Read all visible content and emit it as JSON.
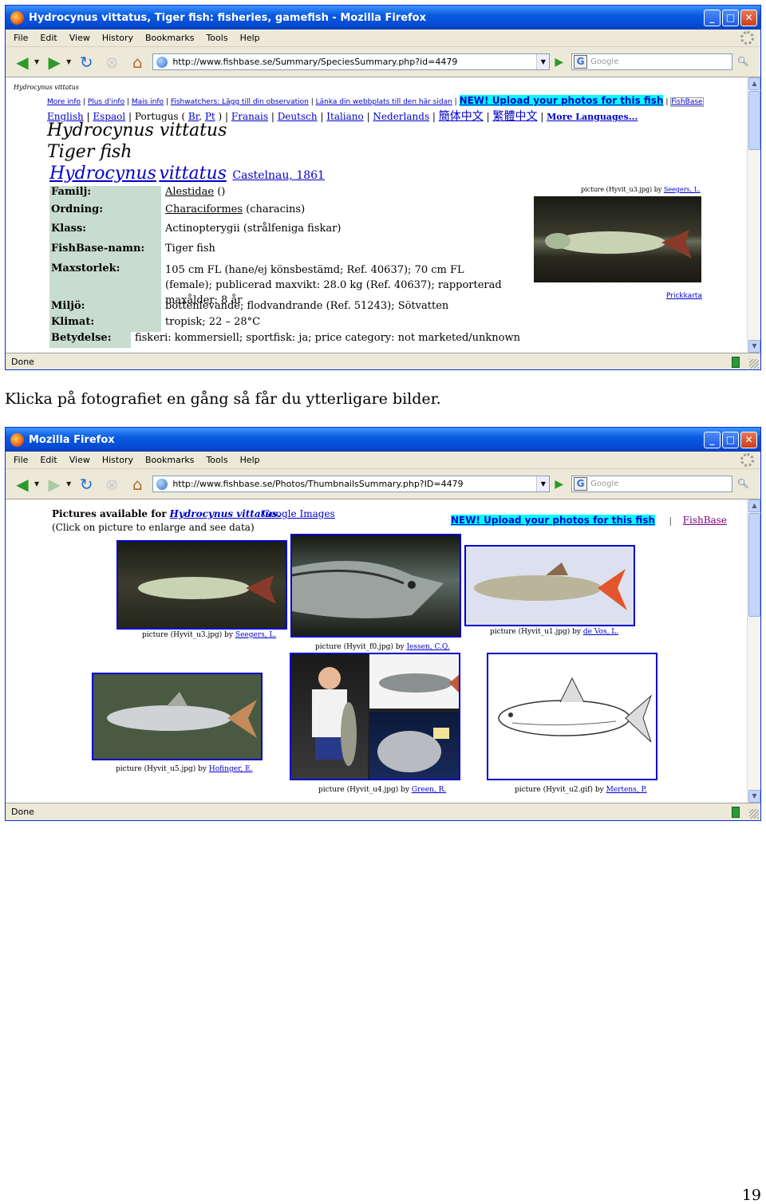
{
  "window1": {
    "title": "Hydrocynus vittatus, Tiger fish: fisheries, gamefish - Mozilla Firefox",
    "url": "http://www.fishbase.se/Summary/SpeciesSummary.php?id=4479",
    "status": "Done"
  },
  "window2": {
    "title": "Mozilla Firefox",
    "url": "http://www.fishbase.se/Photos/ThumbnailsSummary.php?ID=4479",
    "status": "Done"
  },
  "menu": [
    "File",
    "Edit",
    "View",
    "History",
    "Bookmarks",
    "Tools",
    "Help"
  ],
  "search_placeholder": "Google",
  "icons": {
    "back": "back-arrow-icon",
    "forward": "forward-arrow-icon",
    "reload": "reload-icon",
    "stop": "stop-icon",
    "home": "home-icon",
    "go": "go-icon",
    "search": "magnifier-icon"
  },
  "page1": {
    "breadcrumb": "Hydrocynus vittatus",
    "links": [
      "More info",
      "Plus d'info",
      "Mais info",
      "Fishwatchers: Lägg till din observation",
      "Länka din webbplats till den här sidan"
    ],
    "upload": "NEW! Upload your photos for this fish",
    "fishbase": "FishBase",
    "languages": {
      "english": "English",
      "espaol": "Espaol",
      "portugus": "Portugus (",
      "br": "Br",
      "comma": ",",
      "pt": "Pt",
      "close": ")",
      "franais": "Franais",
      "deutsch": "Deutsch",
      "italiano": "Italiano",
      "nederlands": "Nederlands",
      "chs": "簡体中文",
      "cht": "繁體中文",
      "more": "More Languages..."
    },
    "sci_name": "Hydrocynus vittatus",
    "common_name": "Tiger fish",
    "genus": "Hydrocynus",
    "species": "vittatus",
    "author": "Castelnau, 1861",
    "rows": [
      {
        "label": "Familj:",
        "value_link": "Alestidae",
        "value": " ()"
      },
      {
        "label": "Ordning:",
        "value_link": "Characiformes",
        "value": "  (characins)"
      },
      {
        "label": "Klass:",
        "value_link": "",
        "value": "Actinopterygii (strålfeniga fiskar)"
      },
      {
        "label": "FishBase-namn:",
        "value_link": "",
        "value": "Tiger fish"
      },
      {
        "label": "Maxstorlek:",
        "value_link": "",
        "value": "105 cm FL (hane/ej könsbestämd; Ref. 40637); 70 cm FL (female); publicerad maxvikt: 28.0 kg (Ref. 40637); rapporterad maxålder: 8 år"
      },
      {
        "label": "Miljö:",
        "value_link": "",
        "value": "bottenlevande; flodvandrande (Ref. 51243); Sötvatten"
      },
      {
        "label": "Klimat:",
        "value_link": "",
        "value": "tropisk; 22 – 28°C"
      },
      {
        "label": "Betydelse:",
        "value_link": "",
        "value": "fiskeri: kommersiell; sportfisk: ja; price category: not marketed/unknown"
      }
    ],
    "photo_caption": "picture (Hyvit_u3.jpg) by",
    "photo_author": "Seegers, L.",
    "map_link": "Prickkarta"
  },
  "instruction": "Klicka på fotografiet en gång så får du ytterligare bilder.",
  "page2": {
    "pictures_for": "Pictures available for",
    "species": "Hydrocynus vittatus",
    "period": ".",
    "click_note": "(Click on picture to enlarge and see data)",
    "google_images": "Google Images",
    "upload": "NEW! Upload your photos for this fish",
    "separator": "|",
    "fishbase": "FishBase",
    "photos": [
      {
        "caption": "picture (Hyvit_u3.jpg) by",
        "author": "Seegers, L."
      },
      {
        "caption": "picture (Hyvit_f0.jpg) by",
        "author": "Jessen, C.Q."
      },
      {
        "caption": "picture (Hyvit_u1.jpg) by",
        "author": "de Vos, L."
      },
      {
        "caption": "picture (Hyvit_u5.jpg) by",
        "author": "Hofinger, E."
      },
      {
        "caption": "picture (Hyvit_u4.jpg) by",
        "author": "Green, R."
      },
      {
        "caption": "picture (Hyvit_u2.gif) by",
        "author": "Mertens, P."
      }
    ]
  },
  "page_number": "19"
}
